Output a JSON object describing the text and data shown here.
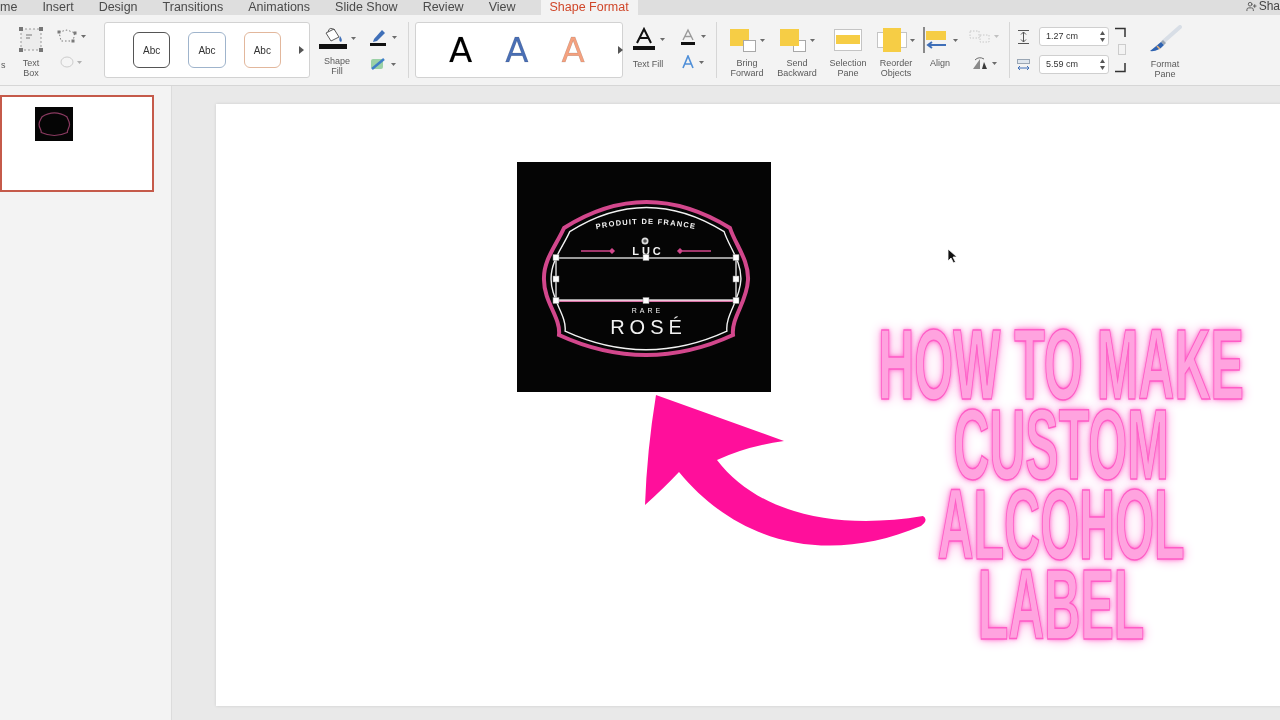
{
  "ribbon_tabs": [
    {
      "label": "me",
      "selected": false
    },
    {
      "label": "Insert",
      "selected": false
    },
    {
      "label": "Design",
      "selected": false
    },
    {
      "label": "Transitions",
      "selected": false
    },
    {
      "label": "Animations",
      "selected": false
    },
    {
      "label": "Slide Show",
      "selected": false
    },
    {
      "label": "Review",
      "selected": false
    },
    {
      "label": "View",
      "selected": false
    },
    {
      "label": "Shape Format",
      "selected": true
    }
  ],
  "share": {
    "label": "Sha"
  },
  "ribbon": {
    "cut_label": "s",
    "text_box": {
      "label": "Text Box"
    },
    "shape_styles": [
      {
        "label": "Abc",
        "color": "#555555"
      },
      {
        "label": "Abc",
        "color": "#9fb4cc"
      },
      {
        "label": "Abc",
        "color": "#e2b79c"
      }
    ],
    "shape_fill": {
      "label": "Shape Fill"
    },
    "wordart_styles": [
      {
        "label": "A",
        "color": "#000000"
      },
      {
        "label": "A",
        "color": "#4a6fb5"
      },
      {
        "label": "A",
        "color": "#f4a17f"
      }
    ],
    "text_fill": {
      "label": "Text Fill"
    },
    "arrange": [
      {
        "kind": "forward",
        "label": "Bring Forward"
      },
      {
        "kind": "backward",
        "label": "Send Backward"
      },
      {
        "kind": "selection",
        "label": "Selection Pane"
      },
      {
        "kind": "reorder",
        "label": "Reorder Objects"
      },
      {
        "kind": "align",
        "label": "Align"
      }
    ],
    "size": {
      "height": "1.27 cm",
      "width": "5.59 cm"
    },
    "format_pane": {
      "label": "Format Pane"
    }
  },
  "slide_thumbnails": [
    {
      "selected": true
    }
  ],
  "slide": {
    "label_art": {
      "top_text": "PRODUIT DE FRANCE",
      "brand": "LUC",
      "subtitle": "RARE",
      "name": "ROSÉ",
      "selected": true
    },
    "title_lines": [
      "HOW TO MAKE",
      "CUSTOM",
      "ALCOHOL",
      "LABEL"
    ]
  }
}
